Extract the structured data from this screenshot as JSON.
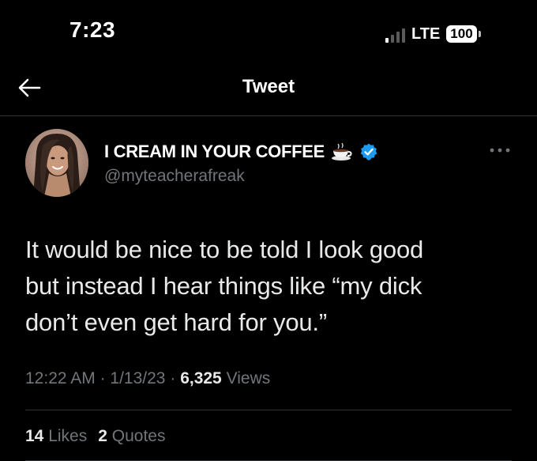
{
  "status_bar": {
    "time": "7:23",
    "network": "LTE",
    "battery": "100"
  },
  "header": {
    "title": "Tweet"
  },
  "tweet": {
    "author_name": "I CREAM IN YOUR COFFEE",
    "author_emoji": "☕",
    "handle": "@myteacherafreak",
    "text": "It would be nice to be told I look good\nbut instead I hear things like “my dick\ndon’t even get hard for you.”",
    "time": "12:22 AM",
    "date": "1/13/23",
    "views_count": "6,325",
    "views_label": "Views",
    "separator": "·",
    "likes_count": "14",
    "likes_label": "Likes",
    "quotes_count": "2",
    "quotes_label": "Quotes"
  },
  "colors": {
    "background": "#000000",
    "text_primary": "#e7e9ea",
    "text_secondary": "#71767b",
    "verified": "#1d9bf0",
    "divider": "#2f3336"
  },
  "icons": {
    "back": "arrow-left-icon",
    "verified": "verified-badge-icon",
    "more": "more-horizontal-icon",
    "signal": "cellular-signal-icon",
    "battery": "battery-icon"
  }
}
